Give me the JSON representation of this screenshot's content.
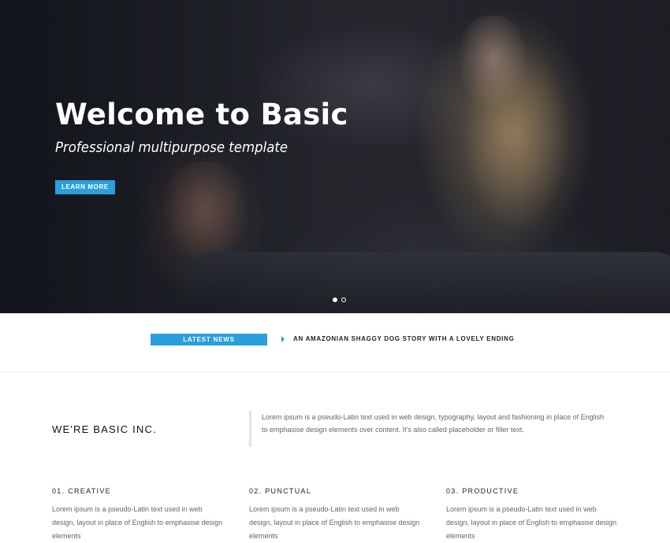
{
  "hero": {
    "title": "Welcome to Basic",
    "subtitle": "Professional multipurpose template",
    "button_label": "LEARN MORE",
    "slides": 2,
    "active_slide": 1
  },
  "news": {
    "label": "LATEST NEWS",
    "headline": "AN AMAZONIAN SHAGGY DOG STORY WITH A LOVELY ENDING"
  },
  "about": {
    "title": "WE'RE BASIC INC.",
    "text": "Lorem ipsum is a pseudo-Latin text used in web design, typography, layout and fashioning in place of English to emphasise design elements over content. It's also called placeholder or filler text."
  },
  "features": [
    {
      "title": "01. CREATIVE",
      "text": "Lorem ipsum is a pseudo-Latin text used in web design, layout in place of English to emphasise design elements"
    },
    {
      "title": "02. PUNCTUAL",
      "text": "Lorem ipsum is a pseudo-Latin text used in web design, layout in place of English to emphasise design elements"
    },
    {
      "title": "03. PRODUCTIVE",
      "text": "Lorem ipsum is a pseudo-Latin text used in web design, layout in place of English to emphasise design elements"
    }
  ],
  "colors": {
    "accent": "#2a9fde",
    "hero_overlay": "#1c1d22",
    "text_dark": "#111111",
    "text_muted": "#666666"
  }
}
